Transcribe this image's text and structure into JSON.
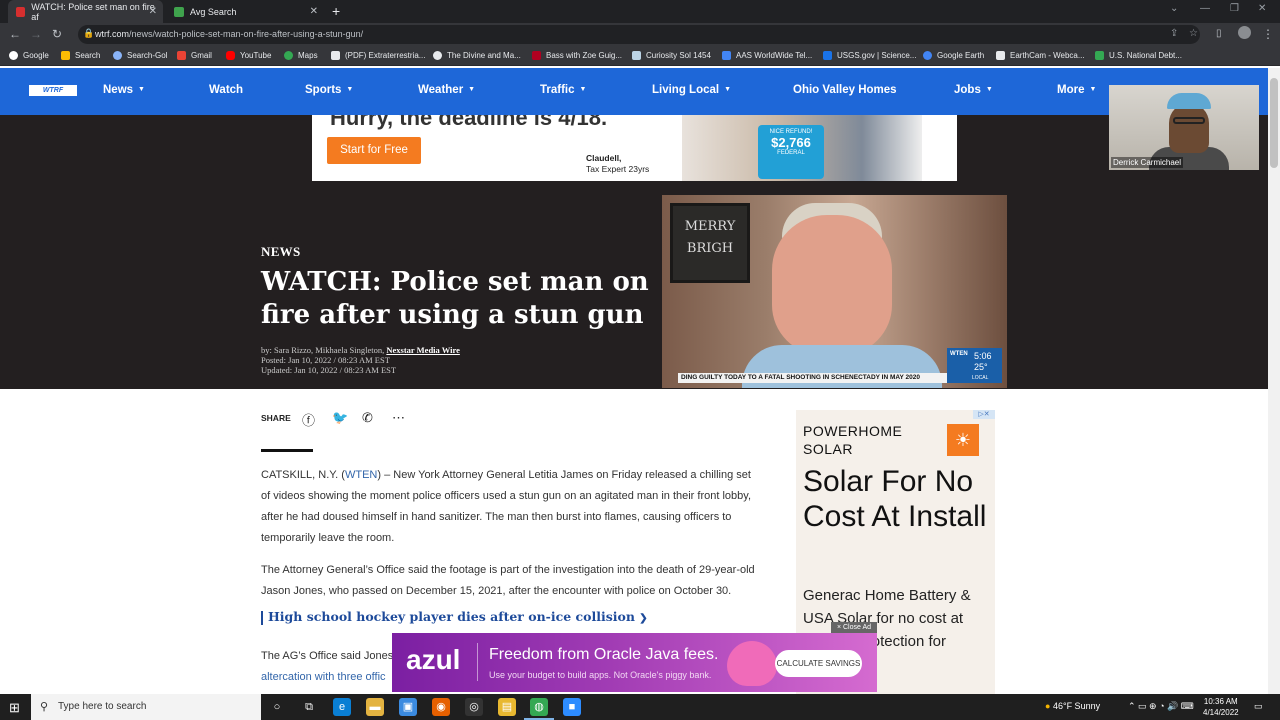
{
  "browser": {
    "tabs": [
      {
        "title": "WATCH: Police set man on fire af",
        "active": true
      },
      {
        "title": "Avg Search",
        "active": false
      }
    ],
    "url_domain": "wtrf.com",
    "url_path": "/news/watch-police-set-man-on-fire-after-using-a-stun-gun/",
    "bookmarks": [
      "Google",
      "Search",
      "Search-Gol",
      "Gmail",
      "YouTube",
      "Maps",
      "(PDF) Extraterrestria...",
      "The Divine and Ma...",
      "Bass with Zoe Guig...",
      "Curiosity Sol 1454",
      "AAS WorldWide Tel...",
      "USGS.gov | Science...",
      "Google Earth",
      "EarthCam - Webca...",
      "U.S. National Debt..."
    ]
  },
  "site": {
    "logo": "WTRF",
    "nav": [
      {
        "label": "News",
        "caret": true
      },
      {
        "label": "Watch",
        "caret": false
      },
      {
        "label": "Sports",
        "caret": true
      },
      {
        "label": "Weather",
        "caret": true
      },
      {
        "label": "Traffic",
        "caret": true
      },
      {
        "label": "Living Local",
        "caret": true
      },
      {
        "label": "Ohio Valley Homes",
        "caret": false
      },
      {
        "label": "Jobs",
        "caret": true
      },
      {
        "label": "More",
        "caret": true
      }
    ]
  },
  "webcam": {
    "name": "Derrick Carmichael"
  },
  "top_ad": {
    "headline": "Hurry, the deadline is 4/18.",
    "button": "Start for Free",
    "refund_top": "NICE REFUND!",
    "refund_amount": "$2,766",
    "refund_bottom": "FEDERAL",
    "expert_name": "Claudell,",
    "expert_title": "Tax Expert 23yrs"
  },
  "article": {
    "kicker": "NEWS",
    "title": "WATCH: Police set man on fire after using a stun gun",
    "byline_prefix": "by: Sara Rizzo, Mikhaela Singleton, ",
    "byline_link": "Nexstar Media Wire",
    "posted": "Posted: Jan 10, 2022 / 08:23 AM EST",
    "updated": "Updated: Jan 10, 2022 / 08:23 AM EST",
    "share_label": "SHARE",
    "p1_start": "CATSKILL, N.Y. (",
    "p1_link": "WTEN",
    "p1_end": ") – New York Attorney General Letitia James on Friday released a chilling set of videos showing the moment police officers used a stun gun on an agitated man in their front lobby, after he had doused himself in hand sanitizer. The man then burst into flames, causing officers to temporarily leave the room.",
    "p2": "The Attorney General’s Office said the footage is part of the investigation into the death of 29-year-old Jason Jones, who passed on December 15, 2021, after the encounter with police on October 30.",
    "related": "High school hockey player dies after on-ice collision",
    "p3_start": "The AG’s Office said Jones",
    "p3_link": "altercation with three offic"
  },
  "video": {
    "sign_line1": "MERRY",
    "sign_line2": "BRIGH",
    "ticker": "DING GUILTY TODAY TO A FATAL SHOOTING IN SCHENECTADY IN MAY 2020",
    "station": "WTEN",
    "time": "5:06",
    "temp": "25°",
    "local": "LOCAL"
  },
  "side_ad": {
    "brand_line1": "POWERHOME",
    "brand_line2": "SOLAR",
    "headline": "Solar For No Cost At Install",
    "body": "Generac Home Battery & USA Solar for no cost at install + protection for"
  },
  "bottom_ad": {
    "close": "× Close Ad",
    "logo": "azul",
    "headline": "Freedom from Oracle Java fees.",
    "sub": "Use your budget to build apps. Not Oracle's piggy bank.",
    "button": "CALCULATE SAVINGS"
  },
  "taskbar": {
    "search_placeholder": "Type here to search",
    "weather": "46°F  Sunny",
    "time": "10:36 AM",
    "date": "4/14/2022"
  }
}
